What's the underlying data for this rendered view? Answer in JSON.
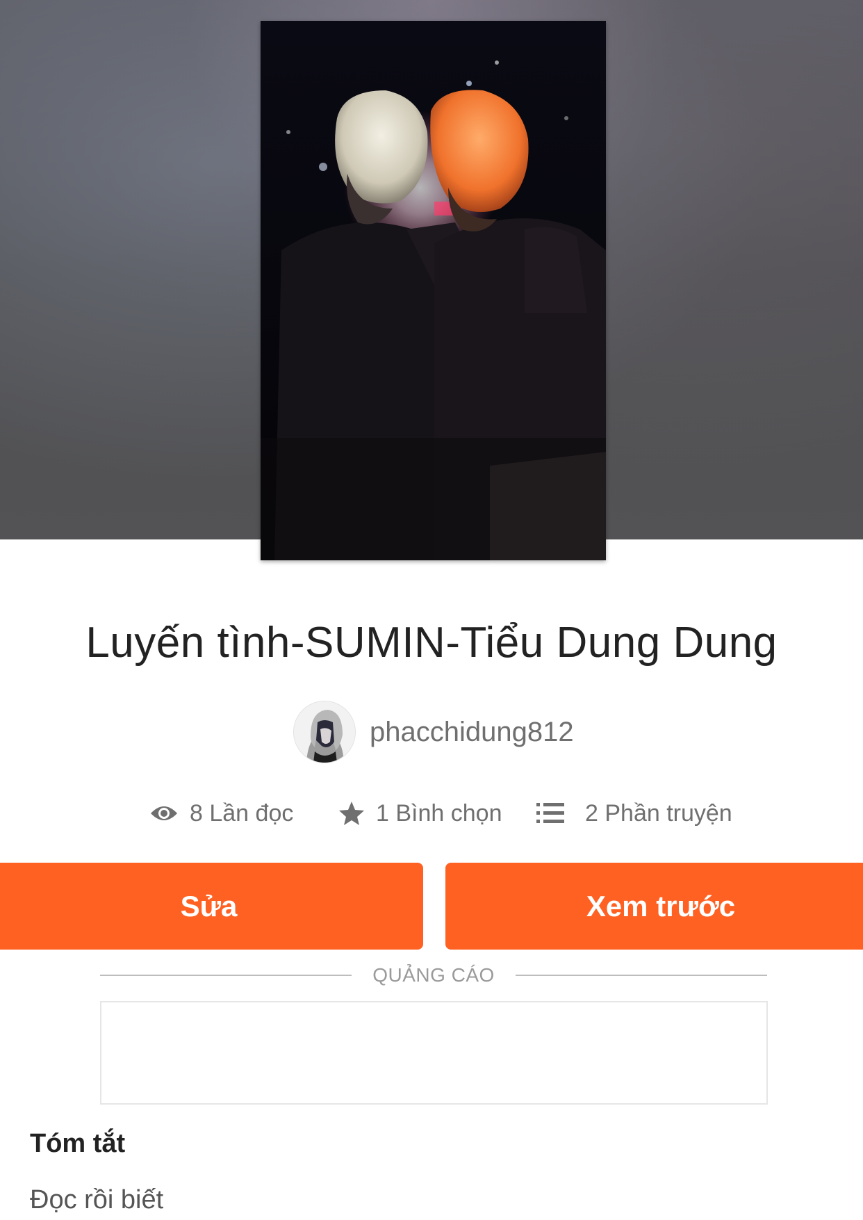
{
  "story": {
    "title": "Luyến tình-SUMIN-Tiểu Dung Dung",
    "author": "phacchidung812"
  },
  "stats": {
    "reads": "8 Lần đọc",
    "votes": "1 Bình chọn",
    "parts": "2 Phần truyện"
  },
  "actions": {
    "edit_label": "Sửa",
    "preview_label": "Xem trước"
  },
  "ad": {
    "label": "QUẢNG CÁO"
  },
  "summary": {
    "heading": "Tóm tắt",
    "text": "Đọc rồi biết"
  },
  "colors": {
    "accent": "#ff6122",
    "text_primary": "#222222",
    "text_secondary": "#6f6f6f"
  },
  "icons": {
    "reads": "eye-icon",
    "votes": "star-icon",
    "parts": "list-icon"
  }
}
